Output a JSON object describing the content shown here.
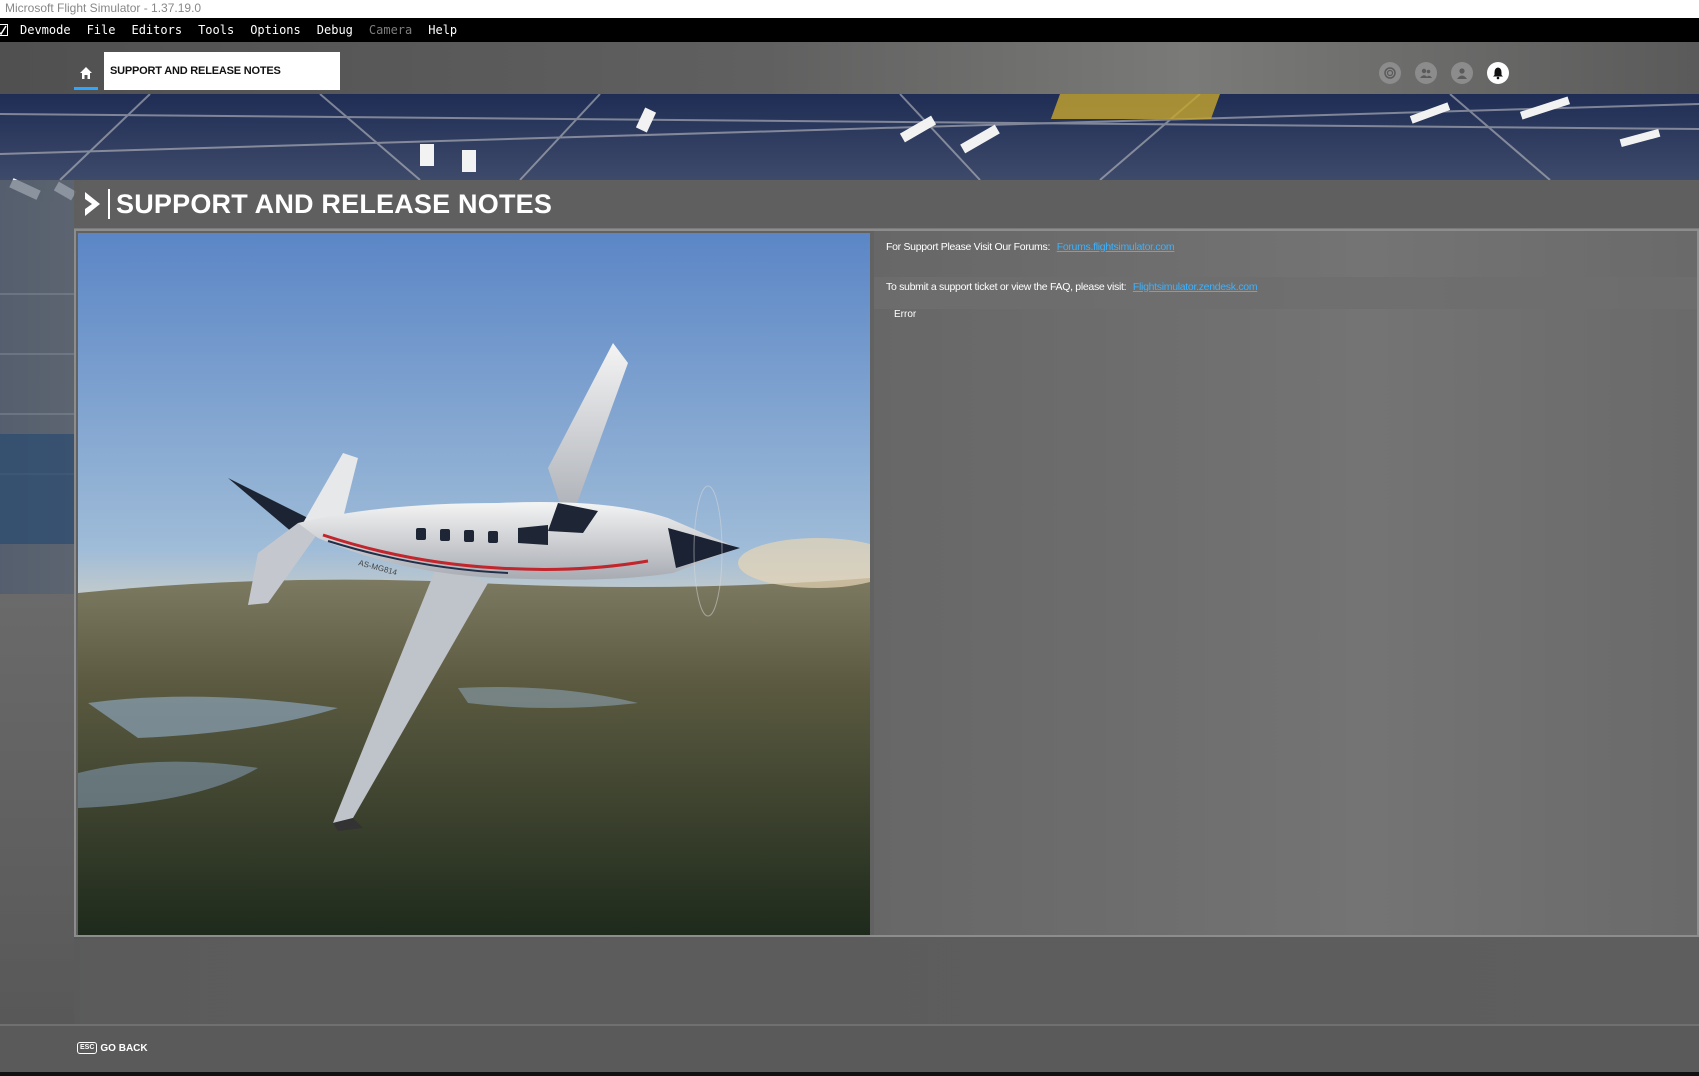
{
  "window": {
    "title": "Microsoft Flight Simulator - 1.37.19.0"
  },
  "menubar": {
    "items": [
      {
        "label": "Devmode",
        "disabled": false
      },
      {
        "label": "File",
        "disabled": false
      },
      {
        "label": "Editors",
        "disabled": false
      },
      {
        "label": "Tools",
        "disabled": false
      },
      {
        "label": "Options",
        "disabled": false
      },
      {
        "label": "Debug",
        "disabled": false
      },
      {
        "label": "Camera",
        "disabled": true
      },
      {
        "label": "Help",
        "disabled": false
      }
    ]
  },
  "topnav": {
    "home_icon": "home-icon",
    "breadcrumb": "SUPPORT AND RELEASE NOTES",
    "icons": [
      "activity-icon",
      "friends-icon",
      "profile-icon",
      "notifications-icon"
    ]
  },
  "page": {
    "title": "SUPPORT AND RELEASE NOTES",
    "aircraft_registration": "AS-MG814"
  },
  "support": {
    "forums_text": "For Support Please Visit Our Forums:",
    "forums_link": "Forums.flightsimulator.com",
    "ticket_text": "To submit a support ticket or view the FAQ, please visit:",
    "ticket_link": "Flightsimulator.zendesk.com",
    "error": "Error"
  },
  "footer": {
    "esc_key": "ESC",
    "go_back": "GO BACK"
  },
  "colors": {
    "accent": "#2ea6ff",
    "link": "#3ab2ff",
    "stripe": "#c0262c"
  }
}
